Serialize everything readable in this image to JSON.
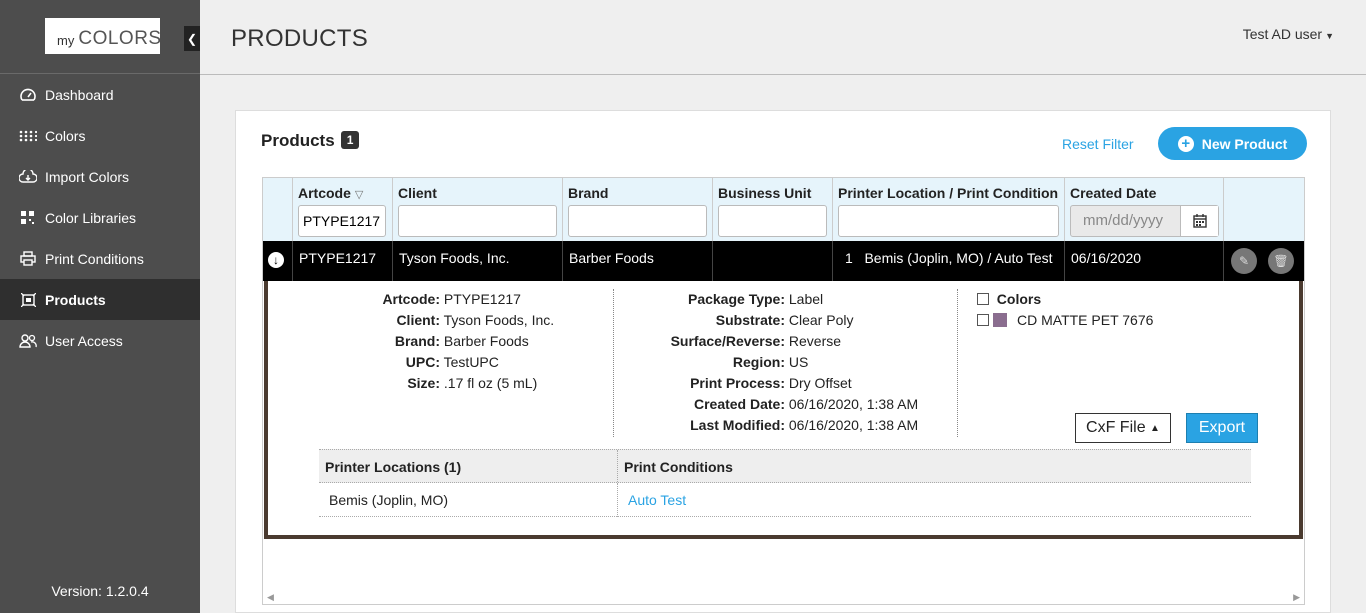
{
  "app": {
    "logo_my": "my",
    "logo_colors": "COLORS",
    "collapse_icon": "chevron-left-icon",
    "version": "Version: 1.2.0.4"
  },
  "sidebar": {
    "items": [
      {
        "label": "Dashboard",
        "icon": "dashboard-icon"
      },
      {
        "label": "Colors",
        "icon": "dots-grid-icon"
      },
      {
        "label": "Import Colors",
        "icon": "cloud-upload-icon"
      },
      {
        "label": "Color Libraries",
        "icon": "library-icon"
      },
      {
        "label": "Print Conditions",
        "icon": "printer-icon"
      },
      {
        "label": "Products",
        "icon": "products-icon",
        "active": true
      },
      {
        "label": "User Access",
        "icon": "users-icon"
      }
    ]
  },
  "header": {
    "title": "PRODUCTS",
    "user": "Test AD user"
  },
  "card": {
    "title": "Products",
    "count": "1",
    "reset_filter": "Reset Filter",
    "new_product": "New Product"
  },
  "grid": {
    "columns": [
      "Artcode",
      "Client",
      "Brand",
      "Business Unit",
      "Printer Location / Print Condition",
      "Created Date"
    ],
    "filters": {
      "artcode": "PTYPE1217",
      "client": "",
      "brand": "",
      "business_unit": "",
      "printer_location": "",
      "created_date_placeholder": "mm/dd/yyyy"
    },
    "row": {
      "artcode": "PTYPE1217",
      "client": "Tyson Foods, Inc.",
      "brand": "Barber Foods",
      "business_unit": "",
      "location_count": "1",
      "location": "Bemis (Joplin, MO) / Auto Test",
      "created_date": "06/16/2020"
    }
  },
  "detail": {
    "left": [
      {
        "label": "Artcode:",
        "value": "PTYPE1217"
      },
      {
        "label": "Client:",
        "value": "Tyson Foods, Inc."
      },
      {
        "label": "Brand:",
        "value": "Barber Foods"
      },
      {
        "label": "UPC:",
        "value": "TestUPC"
      },
      {
        "label": "Size:",
        "value": ".17 fl oz (5 mL)"
      }
    ],
    "middle": [
      {
        "label": "Package Type:",
        "value": "Label"
      },
      {
        "label": "Substrate:",
        "value": "Clear Poly"
      },
      {
        "label": "Surface/Reverse:",
        "value": "Reverse"
      },
      {
        "label": "Region:",
        "value": "US"
      },
      {
        "label": "Print Process:",
        "value": "Dry Offset"
      },
      {
        "label": "Created Date:",
        "value": "06/16/2020, 1:38 AM"
      },
      {
        "label": "Last Modified:",
        "value": "06/16/2020, 1:38 AM"
      }
    ],
    "colors_header": "Colors",
    "color_item": "CD MATTE PET 7676",
    "color_swatch": "#8a6d8f",
    "cxf_button": "CxF File",
    "export_button": "Export",
    "sub_table": {
      "col1": "Printer Locations (1)",
      "col2": "Print Conditions",
      "row_location": "Bemis (Joplin, MO)",
      "row_condition": "Auto Test"
    }
  },
  "colors": {
    "accent": "#2aa3e3",
    "sidebar_bg": "#4d4d4d",
    "row_bg": "#000000"
  }
}
